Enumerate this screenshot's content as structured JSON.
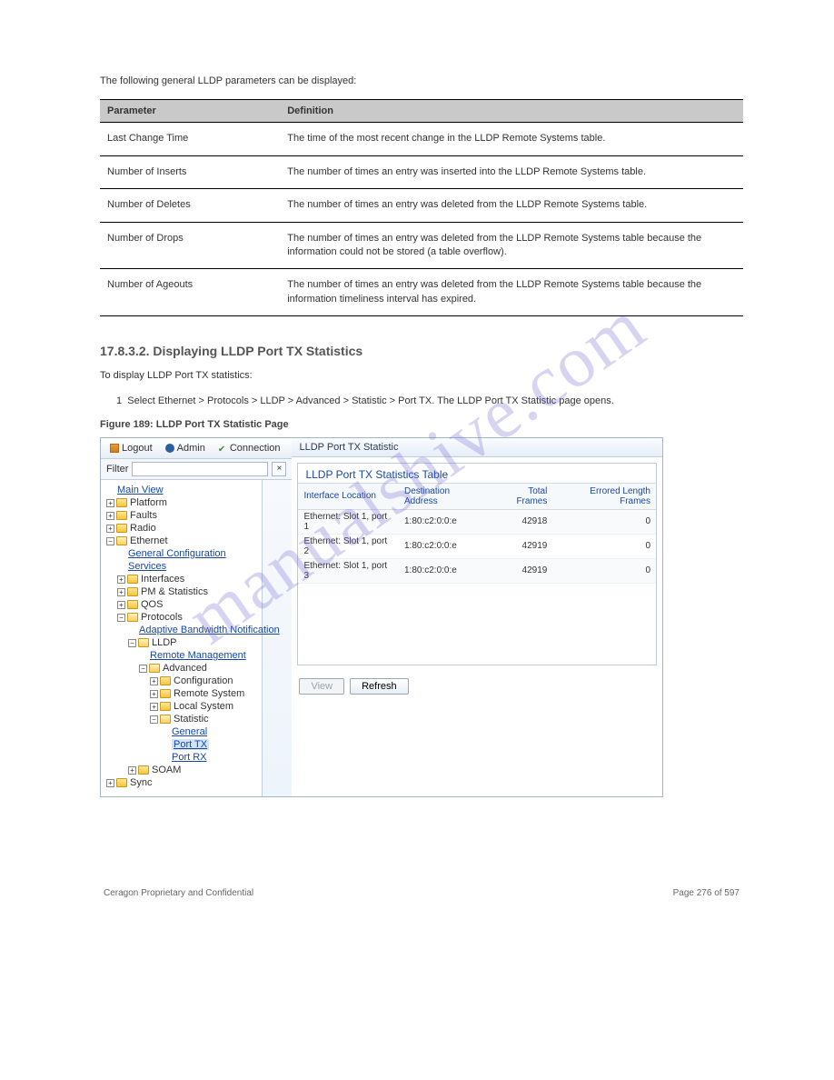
{
  "watermark": "manualshive.com",
  "section": {
    "intro": "The following general LLDP parameters can be displayed:",
    "table1": {
      "headers": [
        "Parameter",
        "Definition"
      ],
      "rows": [
        {
          "param": "Last Change Time",
          "def": "The time of the most recent change in the LLDP Remote Systems table."
        },
        {
          "param": "Number of Inserts",
          "def": "The number of times an entry was inserted into the LLDP Remote Systems table."
        },
        {
          "param": "Number of Deletes",
          "def": "The number of times an entry was deleted from the LLDP Remote Systems table."
        },
        {
          "param": "Number of Drops",
          "def": "The number of times an entry was deleted from the LLDP Remote Systems table because the information could not be stored (a table overflow)."
        },
        {
          "param": "Number of Ageouts",
          "def": "The number of times an entry was deleted from the LLDP Remote Systems table because the information timeliness interval has expired."
        }
      ]
    }
  },
  "tx_section": {
    "heading": "17.8.3.2. Displaying LLDP Port TX Statistics",
    "desc": "To display LLDP Port TX statistics:",
    "step": "Select Ethernet > Protocols > LLDP > Advanced > Statistic > Port TX. The LLDP Port TX Statistic page opens.",
    "fig_caption": "Figure 189: LLDP Port TX Statistic Page"
  },
  "app": {
    "toolbar": {
      "logout": "Logout",
      "admin": "Admin",
      "connection": "Connection"
    },
    "filter_label": "Filter",
    "pane_title": "LLDP Port TX Statistic",
    "subtable_title": "LLDP Port TX Statistics Table",
    "columns": [
      "Interface Location",
      "Destination Address",
      "Total Frames",
      "Errored Length Frames"
    ],
    "rows": [
      {
        "loc": "Ethernet: Slot 1, port 1",
        "dest": "1:80:c2:0:0:e",
        "total": "42918",
        "err": "0"
      },
      {
        "loc": "Ethernet: Slot 1, port 2",
        "dest": "1:80:c2:0:0:e",
        "total": "42919",
        "err": "0"
      },
      {
        "loc": "Ethernet: Slot 1, port 3",
        "dest": "1:80:c2:0:0:e",
        "total": "42919",
        "err": "0"
      }
    ],
    "buttons": {
      "view": "View",
      "refresh": "Refresh"
    },
    "tree": {
      "main_view": "Main View",
      "platform": "Platform",
      "faults": "Faults",
      "radio": "Radio",
      "ethernet": "Ethernet",
      "general_config": "General Configuration",
      "services": "Services",
      "interfaces": "Interfaces",
      "pm_stats": "PM & Statistics",
      "qos": "QOS",
      "protocols": "Protocols",
      "abn": "Adaptive Bandwidth Notification",
      "lldp": "LLDP",
      "remote_mgmt": "Remote Management",
      "advanced": "Advanced",
      "configuration": "Configuration",
      "remote_system": "Remote System",
      "local_system": "Local System",
      "statistic": "Statistic",
      "general": "General",
      "port_tx": "Port TX",
      "port_rx": "Port RX",
      "soam": "SOAM",
      "sync": "Sync"
    }
  },
  "footer": {
    "left": "Ceragon Proprietary and Confidential",
    "right": "Page 276 of 597"
  }
}
